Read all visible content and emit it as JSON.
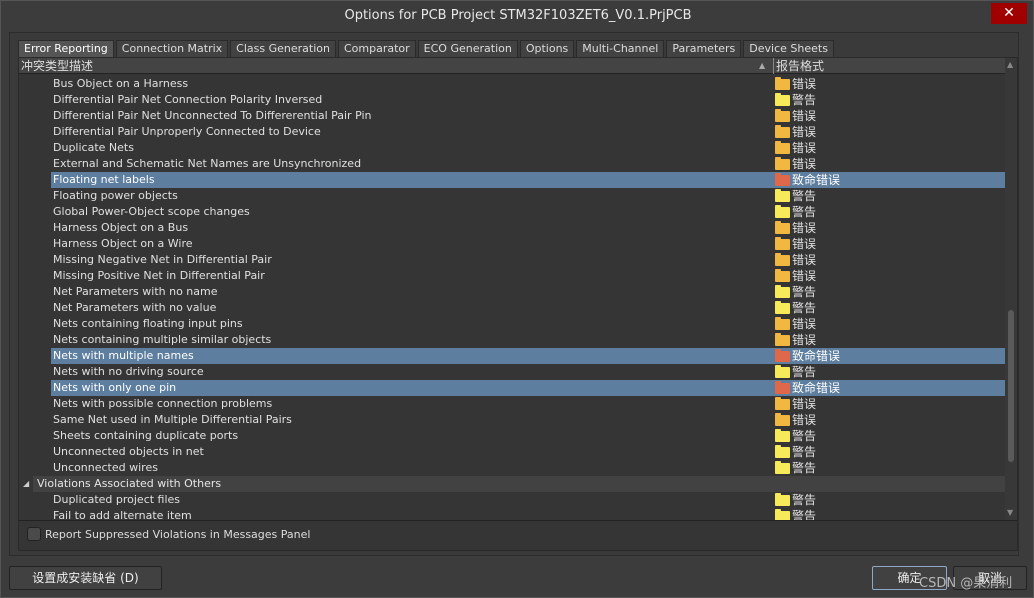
{
  "window": {
    "title": "Options for PCB Project STM32F103ZET6_V0.1.PrjPCB",
    "close": "✕"
  },
  "tabs": [
    "Error Reporting",
    "Connection Matrix",
    "Class Generation",
    "Comparator",
    "ECO Generation",
    "Options",
    "Multi-Channel",
    "Parameters",
    "Device Sheets"
  ],
  "active_tab": "Error Reporting",
  "columns": {
    "description": "冲突类型描述",
    "report_mode": "报告格式"
  },
  "folder_colors": {
    "错误": "#f0b840",
    "警告": "#f6ea5a",
    "致命错误": "#e0684a"
  },
  "rows": [
    {
      "label": "Bus Object on a Harness",
      "mode": "错误"
    },
    {
      "label": "Differential Pair Net Connection Polarity Inversed",
      "mode": "警告"
    },
    {
      "label": "Differential Pair Net Unconnected To Differerential Pair Pin",
      "mode": "错误"
    },
    {
      "label": "Differential Pair Unproperly Connected to Device",
      "mode": "错误"
    },
    {
      "label": "Duplicate Nets",
      "mode": "错误"
    },
    {
      "label": "External and Schematic Net Names are Unsynchronized",
      "mode": "错误"
    },
    {
      "label": "Floating net labels",
      "mode": "致命错误",
      "selected": true
    },
    {
      "label": "Floating power objects",
      "mode": "警告"
    },
    {
      "label": "Global Power-Object scope changes",
      "mode": "警告"
    },
    {
      "label": "Harness Object on a Bus",
      "mode": "错误"
    },
    {
      "label": "Harness Object on a Wire",
      "mode": "错误"
    },
    {
      "label": "Missing Negative Net in Differential Pair",
      "mode": "错误"
    },
    {
      "label": "Missing Positive Net in Differential Pair",
      "mode": "错误"
    },
    {
      "label": "Net Parameters with no name",
      "mode": "警告"
    },
    {
      "label": "Net Parameters with no value",
      "mode": "警告"
    },
    {
      "label": "Nets containing floating input pins",
      "mode": "错误"
    },
    {
      "label": "Nets containing multiple similar objects",
      "mode": "错误"
    },
    {
      "label": "Nets with multiple names",
      "mode": "致命错误",
      "selected": true
    },
    {
      "label": "Nets with no driving source",
      "mode": "警告"
    },
    {
      "label": "Nets with only one pin",
      "mode": "致命错误",
      "selected": true
    },
    {
      "label": "Nets with possible connection problems",
      "mode": "错误"
    },
    {
      "label": "Same Net used in Multiple Differential Pairs",
      "mode": "错误"
    },
    {
      "label": "Sheets containing duplicate ports",
      "mode": "警告"
    },
    {
      "label": "Unconnected objects in net",
      "mode": "警告"
    },
    {
      "label": "Unconnected wires",
      "mode": "警告"
    }
  ],
  "group": {
    "label": "Violations Associated with Others",
    "rows": [
      {
        "label": "Duplicated project files",
        "mode": "警告"
      },
      {
        "label": "Fail to add alternate item",
        "mode": "警告"
      }
    ]
  },
  "checkbox": {
    "label": "Report Suppressed Violations in Messages Panel",
    "checked": false
  },
  "buttons": {
    "defaults": "设置成安装缺省 (D)",
    "ok": "确定",
    "cancel": "取消"
  },
  "watermark": "CSDN @果消利"
}
